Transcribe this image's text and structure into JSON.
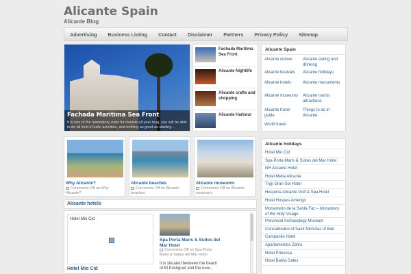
{
  "site": {
    "title": "Alicante Spain",
    "tagline": "Alicante Blog"
  },
  "nav": [
    "Advertising",
    "Business Listing",
    "Contact",
    "Disclaimer",
    "Partners",
    "Privacy Policy",
    "Sitemap"
  ],
  "slider": {
    "title": "Fachada Maritima Sea Front",
    "excerpt": "It is one of the mandatory visits for tourists all year long, you will be able to do all kind of ludic activities, and nothing as good as starting..."
  },
  "slider_thumbs": [
    {
      "title": "Fachada Maritima Sea Front"
    },
    {
      "title": "Alicante Nightlife"
    },
    {
      "title": "Alicante crafts and shopping"
    },
    {
      "title": "Alicante Harbour"
    }
  ],
  "tags_box": {
    "heading": "Alicante Spain",
    "left": [
      "Alicante culture",
      "Alicante festivals",
      "Alicante hotels",
      "Alicante museums",
      "Alicante travel guide",
      "World travel"
    ],
    "right": [
      "Alicante eating and drinking",
      "Alicante holidays",
      "Alicante monuments",
      "Alicante tourist attractions",
      "Things to do in Alicante"
    ]
  },
  "holidays_box": {
    "heading": "Alicante holidays",
    "items": [
      "Hotel Mio Cid",
      "Spa Porta Maris & Suites del Mar Hotel",
      "NH Alicante Hotel",
      "Hotel Melia Alicante",
      "Tryp Gran Sol Hotel",
      "Hesperia Alicante Golf & Spa Hotel",
      "Hotel Hospes Amerigo",
      "Monasterio de la Santa Faz – Monastery of the Holy Visage",
      "Provincial Archaeology Museum",
      "Concathedral of Saint Nicholas of Bari",
      "Campanile Hotel",
      "Apartamentos Zafiro",
      "Hotel Princesa",
      "Hotel Bahia Gales"
    ]
  },
  "cards": [
    {
      "title": "Why Alicante?",
      "meta": "Comments Off on Why Alicante?"
    },
    {
      "title": "Alicante beaches",
      "meta": "Comments Off on Alicante beaches"
    },
    {
      "title": "Alicante museums",
      "meta": "Comments Off on Alicante museums"
    }
  ],
  "hotels_section": {
    "heading": "Alicante hotels",
    "frame_label": "Hotel Mio Cid",
    "left_title": "Hotel Mio Cid",
    "post_title": "Spa Porta Maris & Suites del Mar Hotel",
    "post_meta": "Comments Off on Spa Porta Maris & Suites del Mar Hotel",
    "post_text": "It is situated between the beach of El Postiguet and the new..."
  }
}
